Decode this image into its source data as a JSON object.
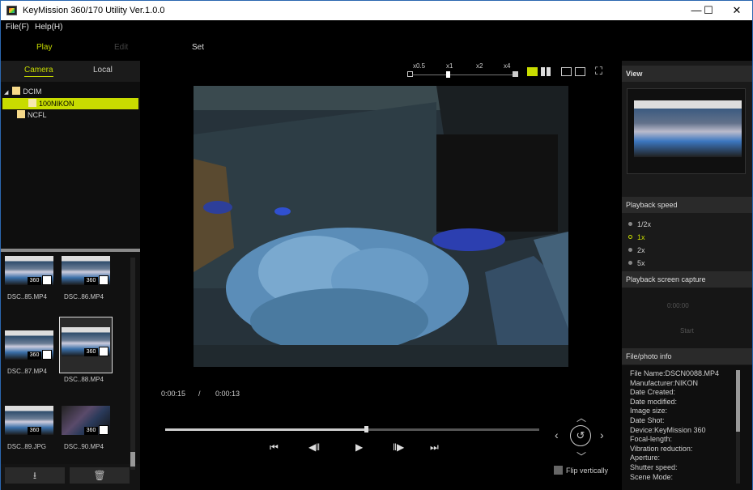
{
  "window": {
    "title": "KeyMission 360/170 Utility Ver.1.0.0",
    "minimize": "—",
    "maximize": "☐",
    "close": "✕"
  },
  "menu": {
    "file": "File(F)",
    "help": "Help(H)"
  },
  "modes": {
    "play": "Play",
    "edit": "Edit",
    "set": "Set"
  },
  "source_tabs": {
    "camera": "Camera",
    "local": "Local"
  },
  "tree": {
    "dcim": "DCIM",
    "nikon": "100NIKON",
    "ncfl": "NCFL"
  },
  "thumbnails": [
    {
      "caption": "DSC..85.MP4",
      "badge": "360"
    },
    {
      "caption": "DSC..86.MP4",
      "badge": "360"
    },
    {
      "caption": "DSC..87.MP4",
      "badge": "360"
    },
    {
      "caption": "DSC..88.MP4",
      "badge": "360"
    },
    {
      "caption": "DSC..89.JPG",
      "badge": "360"
    },
    {
      "caption": "DSC..90.MP4",
      "badge": "360"
    }
  ],
  "zoom": {
    "labels": [
      "x0.5",
      "x1",
      "x2",
      "x4"
    ]
  },
  "player": {
    "current_time": "0:00:15",
    "separator": "/",
    "total_time": "0:00:13",
    "flip_label": "Flip vertically"
  },
  "right": {
    "view_header": "View",
    "speed_header": "Playback speed",
    "speeds": [
      "1/2x",
      "1x",
      "2x",
      "5x"
    ],
    "capture_header": "Playback screen capture",
    "capture_time": "0:00:00",
    "capture_start": "Start",
    "info_header": "File/photo info",
    "info_lines": [
      "File Name:DSCN0088.MP4",
      "Manufacturer:NIKON",
      "Date Created:",
      "Date modified:",
      "Image size:",
      "Date Shot:",
      "Device:KeyMission 360",
      "Focal-length:",
      "Vibration reduction:",
      "Aperture:",
      "Shutter speed:",
      "Scene Mode:"
    ]
  },
  "colors": {
    "accent": "#c8dc00",
    "selected_folder": "#c8dc00",
    "window_border": "#2b67b0"
  }
}
